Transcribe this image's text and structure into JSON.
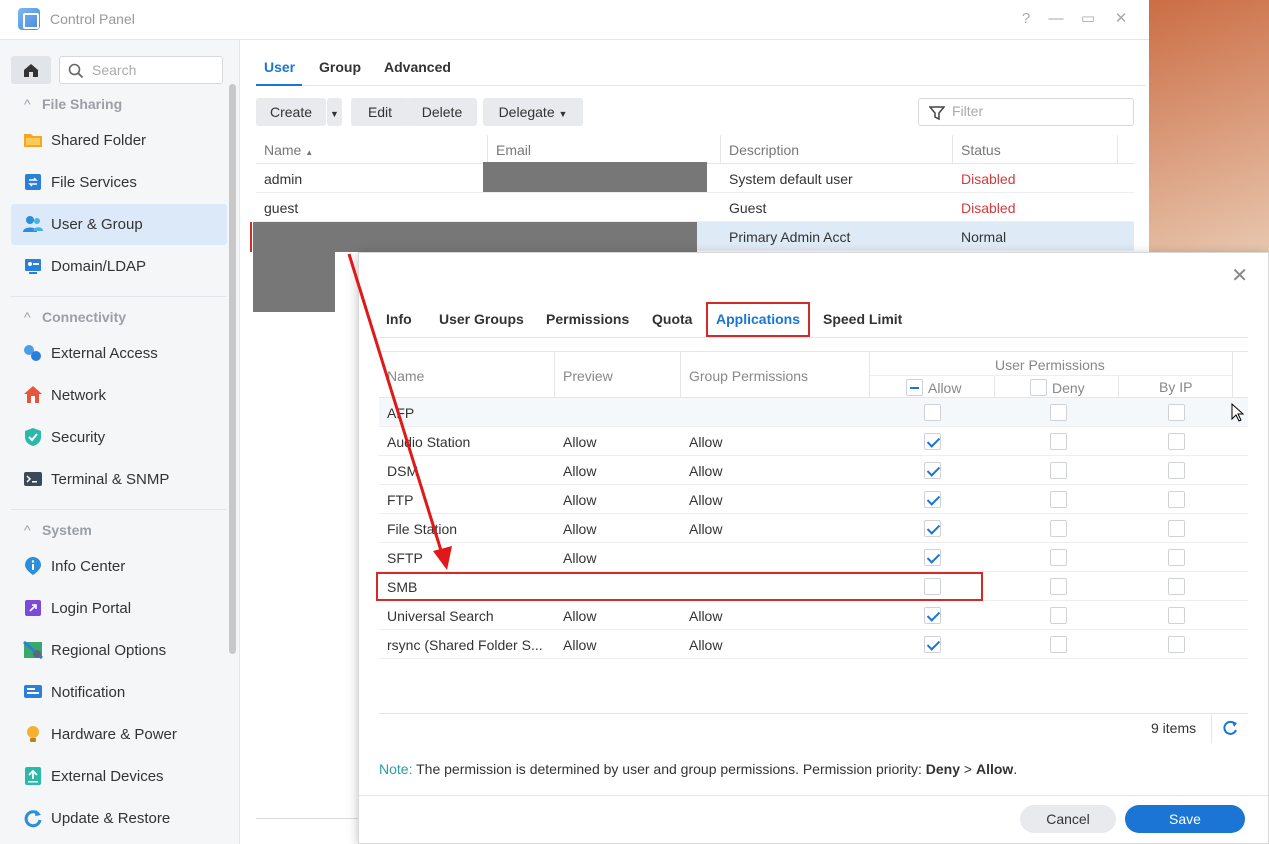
{
  "window": {
    "title": "Control Panel"
  },
  "sidebar": {
    "search_placeholder": "Search",
    "sections": {
      "file_sharing": "File Sharing",
      "connectivity": "Connectivity",
      "system": "System"
    },
    "items": [
      {
        "label": "Shared Folder",
        "icon": "folder-icon"
      },
      {
        "label": "File Services",
        "icon": "file-services-icon"
      },
      {
        "label": "User & Group",
        "icon": "users-icon",
        "active": true
      },
      {
        "label": "Domain/LDAP",
        "icon": "domain-icon"
      },
      {
        "label": "External Access",
        "icon": "external-access-icon"
      },
      {
        "label": "Network",
        "icon": "house-icon"
      },
      {
        "label": "Security",
        "icon": "shield-icon"
      },
      {
        "label": "Terminal & SNMP",
        "icon": "terminal-icon"
      },
      {
        "label": "Info Center",
        "icon": "info-icon"
      },
      {
        "label": "Login Portal",
        "icon": "login-portal-icon"
      },
      {
        "label": "Regional Options",
        "icon": "map-icon"
      },
      {
        "label": "Notification",
        "icon": "notification-icon"
      },
      {
        "label": "Hardware & Power",
        "icon": "bulb-icon"
      },
      {
        "label": "External Devices",
        "icon": "external-device-icon"
      },
      {
        "label": "Update & Restore",
        "icon": "update-icon"
      }
    ]
  },
  "main": {
    "tabs": [
      "User",
      "Group",
      "Advanced"
    ],
    "toolbar": {
      "create": "Create",
      "edit": "Edit",
      "delete": "Delete",
      "delegate": "Delegate"
    },
    "filter_placeholder": "Filter",
    "columns": [
      "Name",
      "Email",
      "Description",
      "Status"
    ],
    "rows": [
      {
        "name": "admin",
        "description": "System default user",
        "status": "Disabled"
      },
      {
        "name": "guest",
        "description": "Guest",
        "status": "Disabled"
      },
      {
        "name": "",
        "description": "Primary Admin Acct",
        "status": "Normal"
      }
    ]
  },
  "dialog": {
    "tabs": [
      "Info",
      "User Groups",
      "Permissions",
      "Quota",
      "Applications",
      "Speed Limit"
    ],
    "active_tab": "Applications",
    "columns": {
      "name": "Name",
      "preview": "Preview",
      "group": "Group Permissions",
      "user_permissions": "User Permissions",
      "allow": "Allow",
      "deny": "Deny",
      "byip": "By IP"
    },
    "rows": [
      {
        "name": "AFP",
        "preview": "",
        "group": "",
        "allow": false
      },
      {
        "name": "Audio Station",
        "preview": "Allow",
        "group": "Allow",
        "allow": true
      },
      {
        "name": "DSM",
        "preview": "Allow",
        "group": "Allow",
        "allow": true
      },
      {
        "name": "FTP",
        "preview": "Allow",
        "group": "Allow",
        "allow": true
      },
      {
        "name": "File Station",
        "preview": "Allow",
        "group": "Allow",
        "allow": true
      },
      {
        "name": "SFTP",
        "preview": "Allow",
        "group": "",
        "allow": true
      },
      {
        "name": "SMB",
        "preview": "",
        "group": "",
        "allow": false
      },
      {
        "name": "Universal Search",
        "preview": "Allow",
        "group": "Allow",
        "allow": true
      },
      {
        "name": "rsync (Shared Folder S...",
        "preview": "Allow",
        "group": "Allow",
        "allow": true
      }
    ],
    "items_count": "9 items",
    "note_label": "Note:",
    "note_text": " The permission is determined by user and group permissions. Permission priority: ",
    "note_deny": "Deny",
    "note_gt": " > ",
    "note_allow": "Allow",
    "note_end": ".",
    "cancel": "Cancel",
    "save": "Save"
  },
  "colors": {
    "accent": "#1a75d4",
    "disabled": "#d43a3a",
    "annotation": "#d42a2a"
  }
}
